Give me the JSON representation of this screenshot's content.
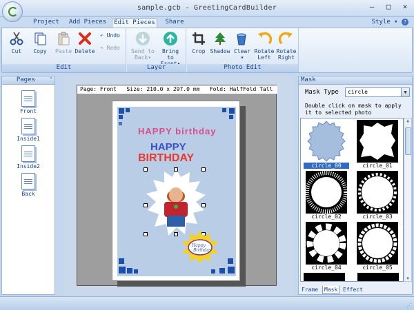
{
  "window": {
    "title": "sample.gcb - GreetingCardBuilder"
  },
  "tabs": [
    {
      "label": "Project"
    },
    {
      "label": "Add Pieces"
    },
    {
      "label": "Edit Pieces"
    },
    {
      "label": "Share"
    }
  ],
  "style_menu": "Style",
  "ribbon": {
    "groups": {
      "edit": "Edit",
      "layer": "Layer",
      "photo_edit": "Photo Edit"
    },
    "edit": {
      "cut": "Cut",
      "copy": "Copy",
      "paste": "Paste",
      "delete": "Delete",
      "undo": "Undo",
      "redo": "Redo"
    },
    "layer": {
      "send_to_back_1": "Send to",
      "send_to_back_2": "Back",
      "bring_to_front_1": "Bring to",
      "bring_to_front_2": "Front"
    },
    "photo": {
      "crop": "Crop",
      "shadow": "Shadow",
      "clear": "Clear",
      "rotate_left_1": "Rotate",
      "rotate_left_2": "Left",
      "rotate_right_1": "Rotate",
      "rotate_right_2": "Right"
    }
  },
  "pages_panel": {
    "title": "Pages",
    "items": [
      {
        "label": "Front"
      },
      {
        "label": "Inside1"
      },
      {
        "label": "Inside2"
      },
      {
        "label": "Back"
      }
    ]
  },
  "canvas": {
    "info": "Page: Front   Size: 210.0 x 297.0 mm   Fold: HalfFold Tall"
  },
  "card": {
    "line1": "HAPPY birthday",
    "line2": "HAPPY",
    "line3": "BIRTHDAY",
    "cake_text_1": "Happy",
    "cake_text_2": "Birthday"
  },
  "mask_panel": {
    "title": "Mask",
    "type_label": "Mask Type",
    "type_value": "circle",
    "description": "Double click on mask to apply it to selected photo",
    "thumbnails": [
      {
        "label": "circle_00"
      },
      {
        "label": "circle_01"
      },
      {
        "label": "circle_02"
      },
      {
        "label": "circle_03"
      },
      {
        "label": "circle_04"
      },
      {
        "label": "circle_05"
      }
    ],
    "bottom_tabs": [
      {
        "label": "Frame"
      },
      {
        "label": "Mask"
      },
      {
        "label": "Effect"
      }
    ]
  }
}
